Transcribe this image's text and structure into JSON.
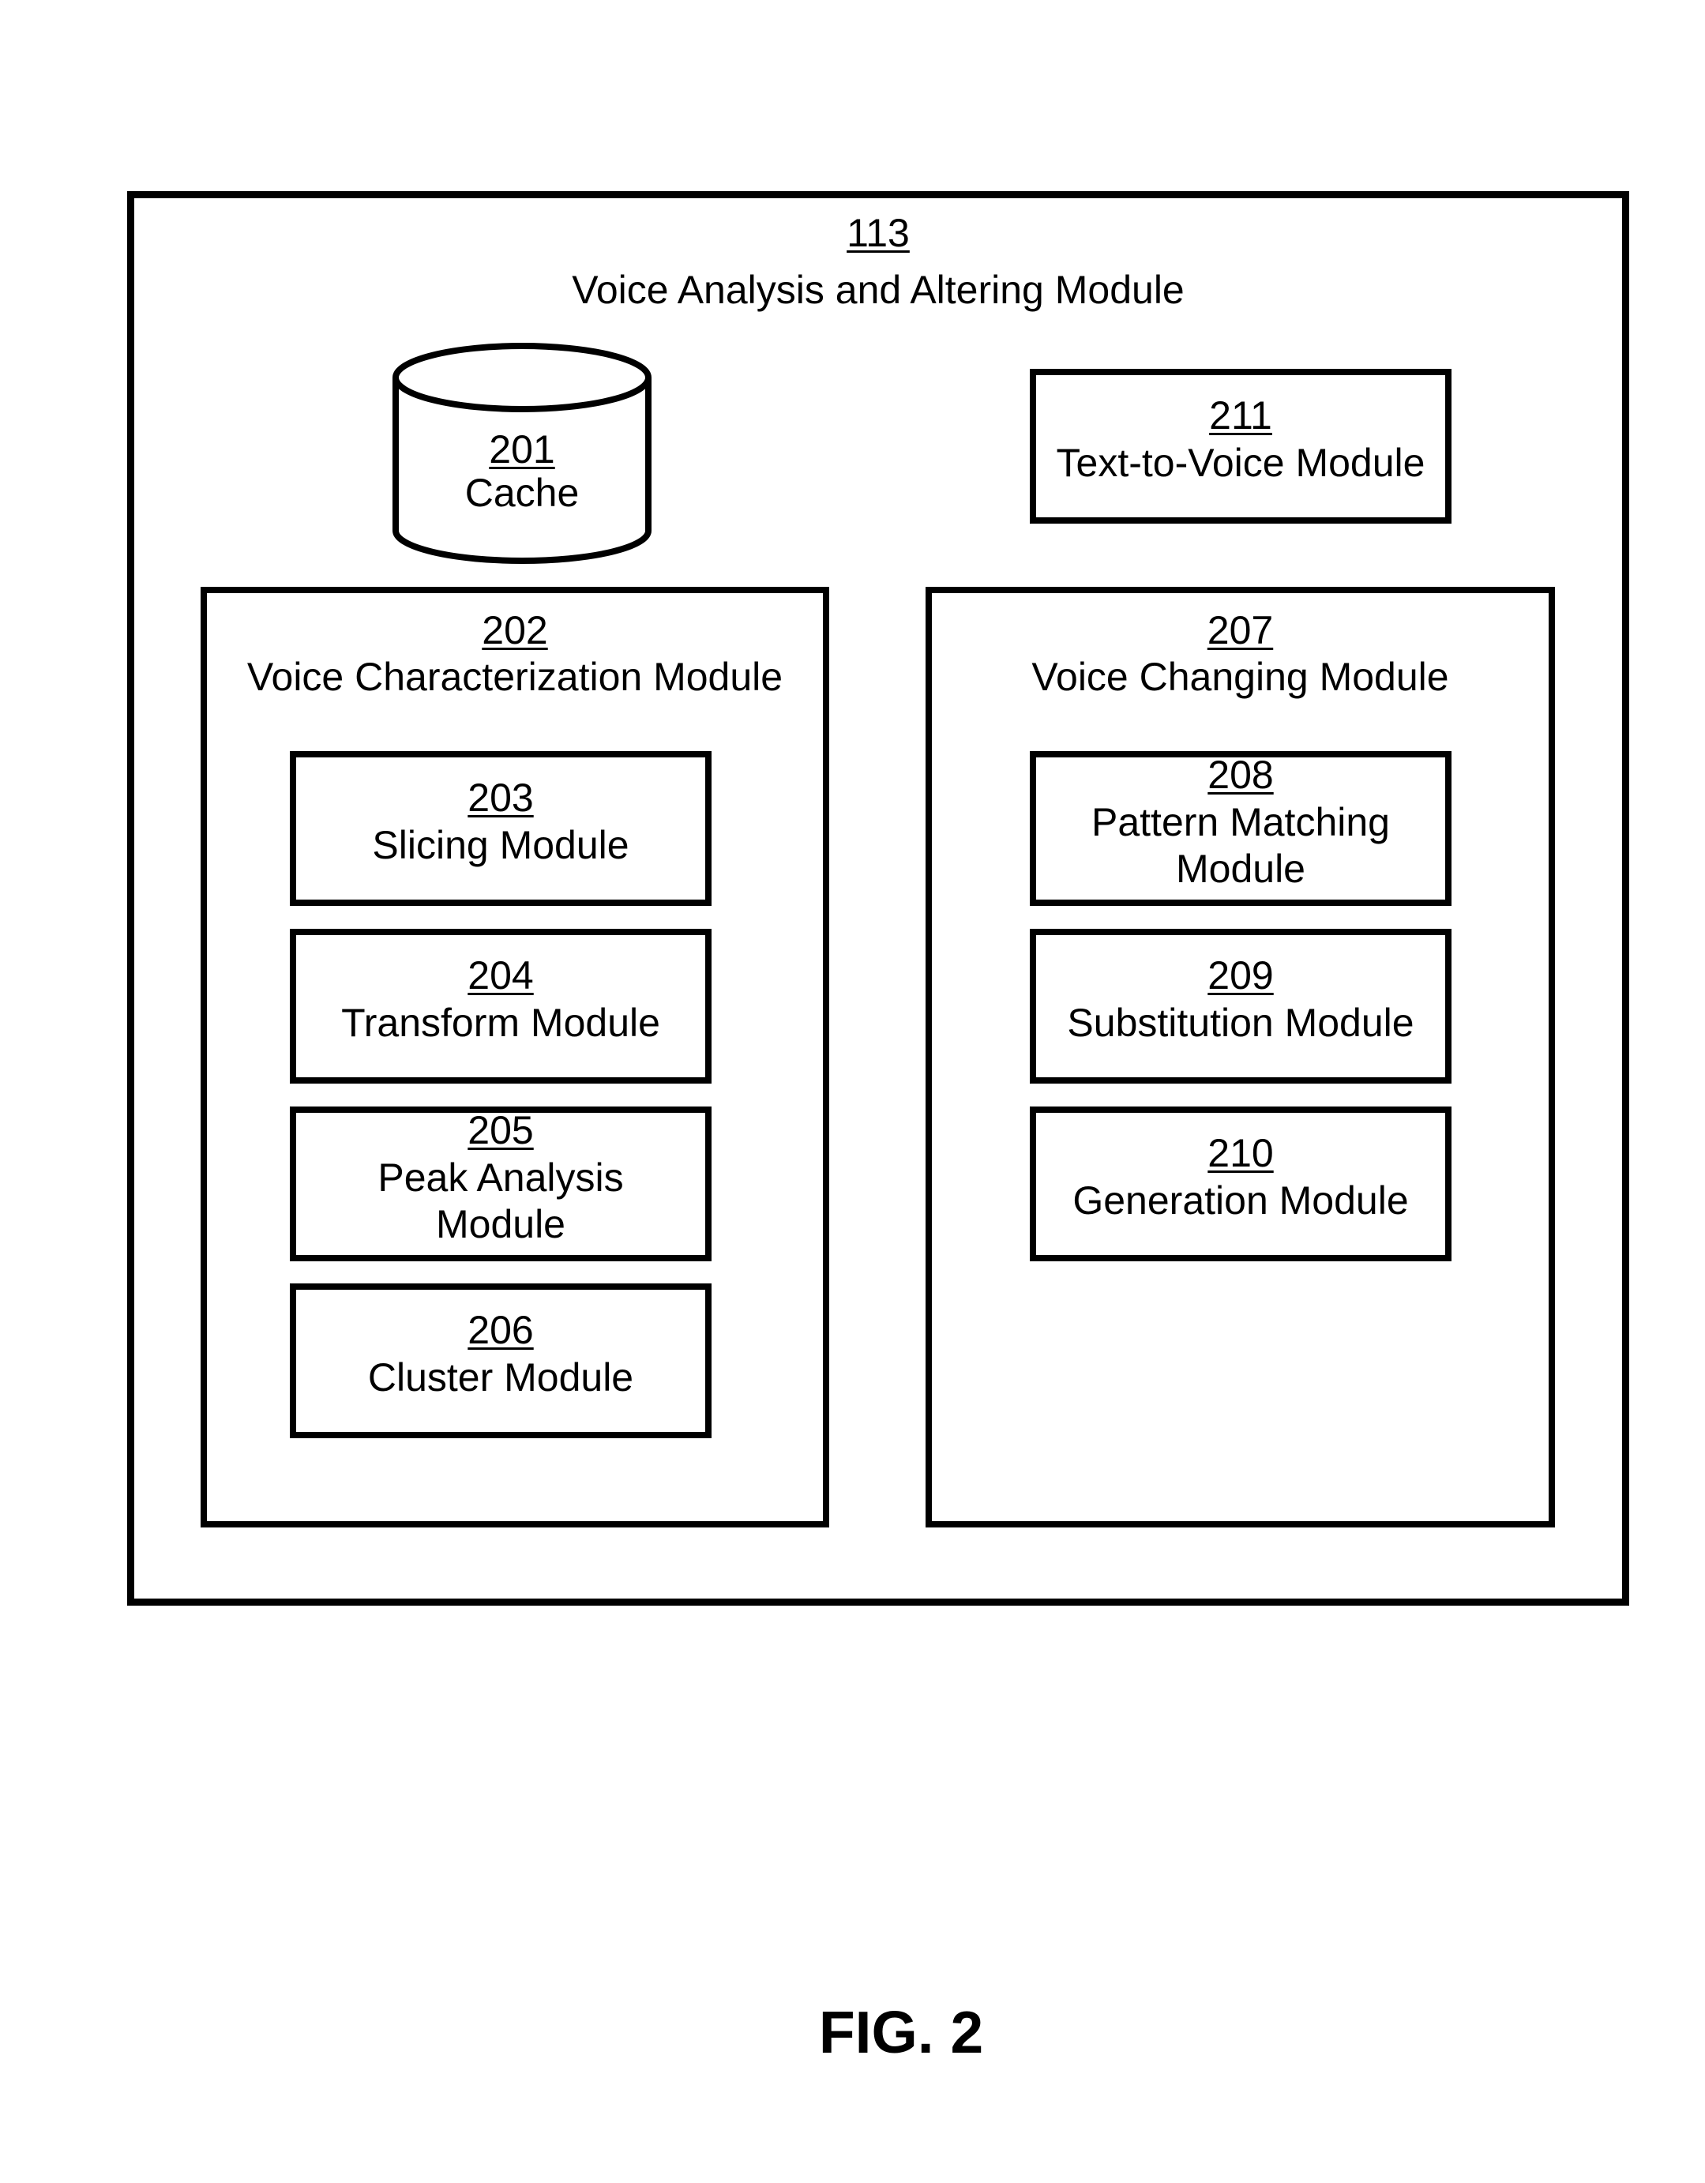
{
  "figure_label": "FIG. 2",
  "outer_module": {
    "ref": "113",
    "name": "Voice Analysis and Altering Module"
  },
  "cache": {
    "ref": "201",
    "name": "Cache",
    "shape": "cylinder-icon"
  },
  "text_to_voice": {
    "ref": "211",
    "name": "Text-to-Voice Module"
  },
  "voice_characterization": {
    "ref": "202",
    "name": "Voice Characterization Module",
    "children": [
      {
        "ref": "203",
        "lines": [
          "Slicing Module"
        ]
      },
      {
        "ref": "204",
        "lines": [
          "Transform Module"
        ]
      },
      {
        "ref": "205",
        "lines": [
          "Peak Analysis",
          "Module"
        ]
      },
      {
        "ref": "206",
        "lines": [
          "Cluster Module"
        ]
      }
    ]
  },
  "voice_changing": {
    "ref": "207",
    "name": "Voice Changing Module",
    "children": [
      {
        "ref": "208",
        "lines": [
          "Pattern Matching",
          "Module"
        ]
      },
      {
        "ref": "209",
        "lines": [
          "Substitution Module"
        ]
      },
      {
        "ref": "210",
        "lines": [
          "Generation Module"
        ]
      }
    ]
  }
}
